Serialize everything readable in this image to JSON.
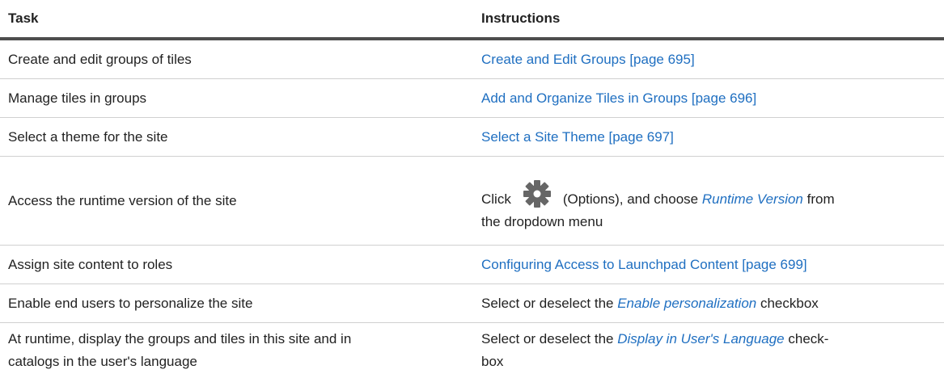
{
  "header": {
    "task": "Task",
    "instructions": "Instructions"
  },
  "rows": [
    {
      "task": "Create and edit groups of tiles",
      "link": "Create and Edit Groups [page 695]"
    },
    {
      "task": "Manage tiles in groups",
      "link": "Add and Organize Tiles in Groups [page 696]"
    },
    {
      "task": "Select a theme for the site",
      "link": "Select a Site Theme [page 697]"
    },
    {
      "task": "Access the runtime version of the site",
      "pre": "Click",
      "icon": "gear-icon",
      "mid": "(Options), and choose",
      "em": "Runtime Version",
      "post1": "from",
      "post2": "the dropdown menu"
    },
    {
      "task": "Assign site content to roles",
      "link": "Configuring Access to Launchpad Content [page 699]"
    },
    {
      "task": "Enable end users to personalize the site",
      "pre": "Select or deselect the",
      "em": "Enable personalization",
      "post": "checkbox"
    },
    {
      "task1": "At runtime, display the groups and tiles in this site and in",
      "task2": "catalogs in the user's language",
      "pre": "Select or deselect the",
      "em": "Display in User's Language",
      "post1": "check-",
      "post2": "box"
    }
  ],
  "colors": {
    "link": "#1f6fc1",
    "text": "#222222",
    "header_rule": "#4d4d4d"
  }
}
